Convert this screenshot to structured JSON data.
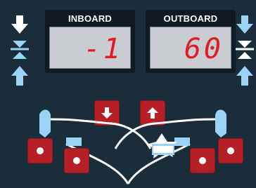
{
  "displays": {
    "inboard": {
      "label": "INBOARD",
      "value": "-1"
    },
    "outboard": {
      "label": "OUTBOARD",
      "value": "60"
    }
  },
  "colors": {
    "panel": "#1a2d3a",
    "lcd_bg": "#c9ccd0",
    "lcd_digits": "#e21b2b",
    "button": "#b51f26",
    "white": "#ffffff",
    "accent_blue": "#9bd3f5"
  },
  "icons": {
    "left_side": [
      "arrow-down-icon",
      "compress-icon",
      "arrow-up-icon"
    ],
    "right_side": [
      "arrow-down-icon",
      "compress-icon",
      "arrow-up-icon"
    ],
    "center_buttons": [
      "arrow-down-icon",
      "arrow-up-icon"
    ],
    "wheel": "wheel-profile-icon"
  }
}
